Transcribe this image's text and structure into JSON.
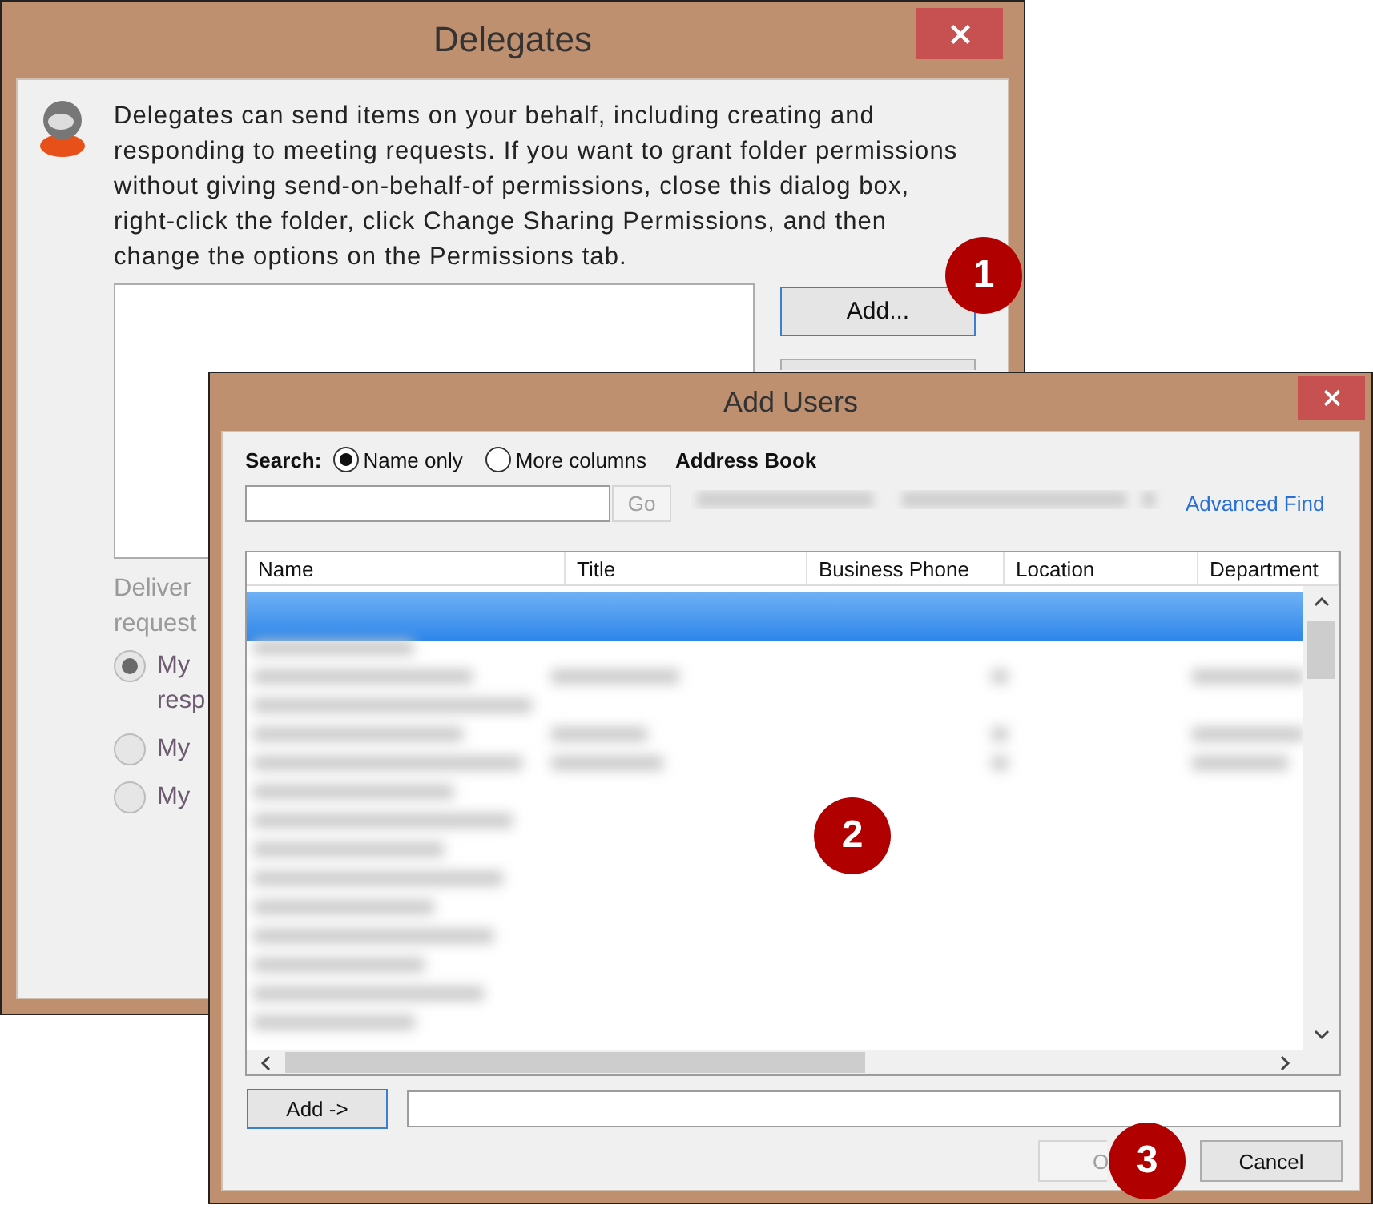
{
  "delegates_window": {
    "title": "Delegates",
    "description": "Delegates can send items on your behalf, including creating and responding to meeting requests. If you want to grant folder permissions without giving send-on-behalf-of permissions, close this dialog box, right-click the folder, click Change Sharing Permissions, and then change the options on the Permissions tab.",
    "add_button": {
      "label": "Add...",
      "focused": true
    },
    "deliver_label": [
      "Deliver",
      "request"
    ],
    "options_disabled": true,
    "options": [
      {
        "label": "My",
        "continuation": "resp",
        "selected": true
      },
      {
        "label": "My",
        "selected": false
      },
      {
        "label": "My",
        "selected": false
      }
    ]
  },
  "add_users_window": {
    "title": "Add Users",
    "search_label": "Search:",
    "search_modes": [
      {
        "label": "Name only",
        "selected": true
      },
      {
        "label": "More columns",
        "selected": false
      }
    ],
    "address_book_label": "Address Book",
    "go_button": {
      "label": "Go",
      "disabled": true
    },
    "advanced_find": "Advanced Find",
    "table": {
      "columns": [
        "Name",
        "Title",
        "Business Phone",
        "Location",
        "Department"
      ]
    },
    "add_button": {
      "label": "Add ->",
      "focused": true
    },
    "ok_button": {
      "label": "O",
      "disabled": true
    },
    "cancel_button": {
      "label": "Cancel",
      "disabled": false
    }
  },
  "callouts": [
    "1",
    "2",
    "3"
  ]
}
